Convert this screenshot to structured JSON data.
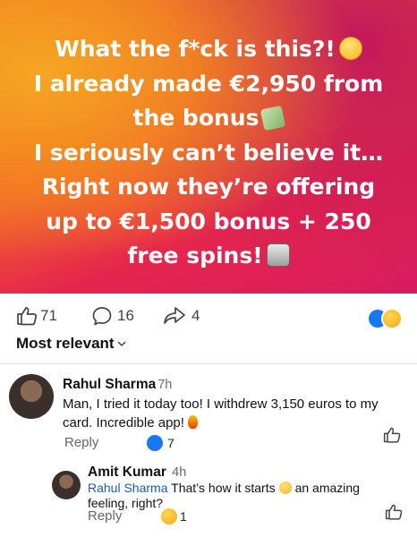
{
  "post": {
    "lines": [
      "What the f*ck is this?!",
      "I already made €2,950 from",
      "the bonus",
      "I seriously can’t believe it…",
      "Right now they’re offering",
      "up to €1,500 bonus + 250",
      "free spins!"
    ]
  },
  "actions": {
    "likes": "71",
    "comments": "16",
    "shares": "4"
  },
  "sort_label": "Most relevant",
  "comments": [
    {
      "name": "Rahul Sharma",
      "time": "7h",
      "text": "Man, I tried it today too! I withdrew 3,150 euros to my card. Incredible app!",
      "reply_label": "Reply",
      "reaction_count": "7"
    },
    {
      "name": "Amit Kumar",
      "time": "4h",
      "mention": "Rahul Sharma",
      "text_a": "That’s how it starts",
      "text_b": "an amazing",
      "text_c": "feeling, right?",
      "reply_label": "Reply",
      "reaction_count": "1"
    }
  ],
  "colors": {
    "like_blue": "#1877f2",
    "mention_blue": "#1a5ca8",
    "meta_gray": "#65676b"
  }
}
